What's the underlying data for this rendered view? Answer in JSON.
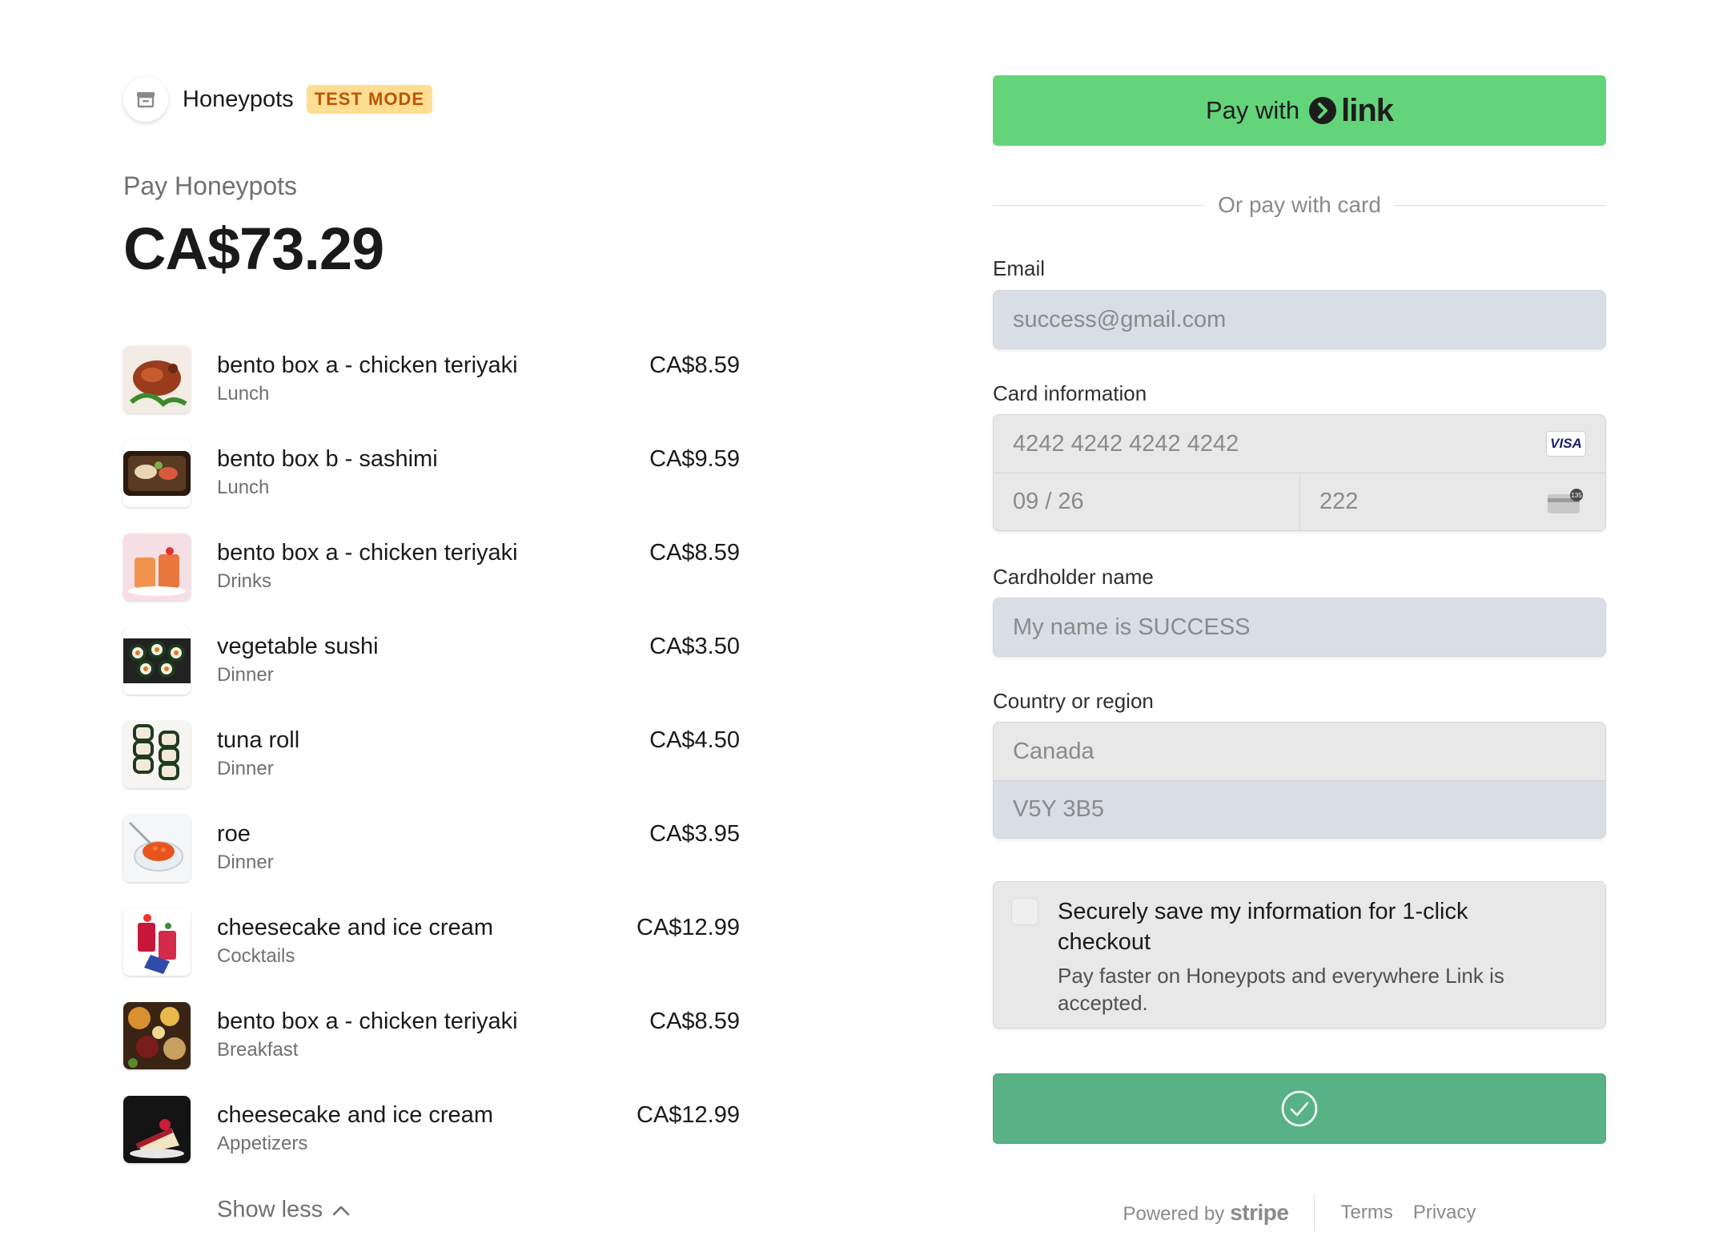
{
  "merchant": {
    "name": "Honeypots",
    "badge": "TEST MODE",
    "pay_label": "Pay Honeypots",
    "total": "CA$73.29"
  },
  "items": [
    {
      "name": "bento box a - chicken teriyaki",
      "category": "Lunch",
      "price": "CA$8.59"
    },
    {
      "name": "bento box b - sashimi",
      "category": "Lunch",
      "price": "CA$9.59"
    },
    {
      "name": "bento box a - chicken teriyaki",
      "category": "Drinks",
      "price": "CA$8.59"
    },
    {
      "name": "vegetable sushi",
      "category": "Dinner",
      "price": "CA$3.50"
    },
    {
      "name": "tuna roll",
      "category": "Dinner",
      "price": "CA$4.50"
    },
    {
      "name": "roe",
      "category": "Dinner",
      "price": "CA$3.95"
    },
    {
      "name": "cheesecake and ice cream",
      "category": "Cocktails",
      "price": "CA$12.99"
    },
    {
      "name": "bento box a - chicken teriyaki",
      "category": "Breakfast",
      "price": "CA$8.59"
    },
    {
      "name": "cheesecake and ice cream",
      "category": "Appetizers",
      "price": "CA$12.99"
    }
  ],
  "show_less": "Show less",
  "link_button": {
    "prefix": "Pay with",
    "brand": "link"
  },
  "divider_text": "Or pay with card",
  "email": {
    "label": "Email",
    "value": "success@gmail.com"
  },
  "card": {
    "label": "Card information",
    "number": "4242 4242 4242 4242",
    "brand": "VISA",
    "expiry": "09 / 26",
    "cvc": "222",
    "cvc_icon_text": "135"
  },
  "cardholder": {
    "label": "Cardholder name",
    "value": "My name is SUCCESS"
  },
  "country": {
    "label": "Country or region",
    "value": "Canada",
    "postal": "V5Y 3B5"
  },
  "save_info": {
    "title": "Securely save my information for 1-click checkout",
    "description": "Pay faster on Honeypots and everywhere Link is accepted."
  },
  "footer": {
    "powered_by": "Powered by",
    "stripe": "stripe",
    "terms": "Terms",
    "privacy": "Privacy"
  },
  "colors": {
    "link_green": "#63d47a",
    "submit_green": "#58b286",
    "badge_bg": "#ffde92",
    "badge_text": "#bb5504"
  }
}
